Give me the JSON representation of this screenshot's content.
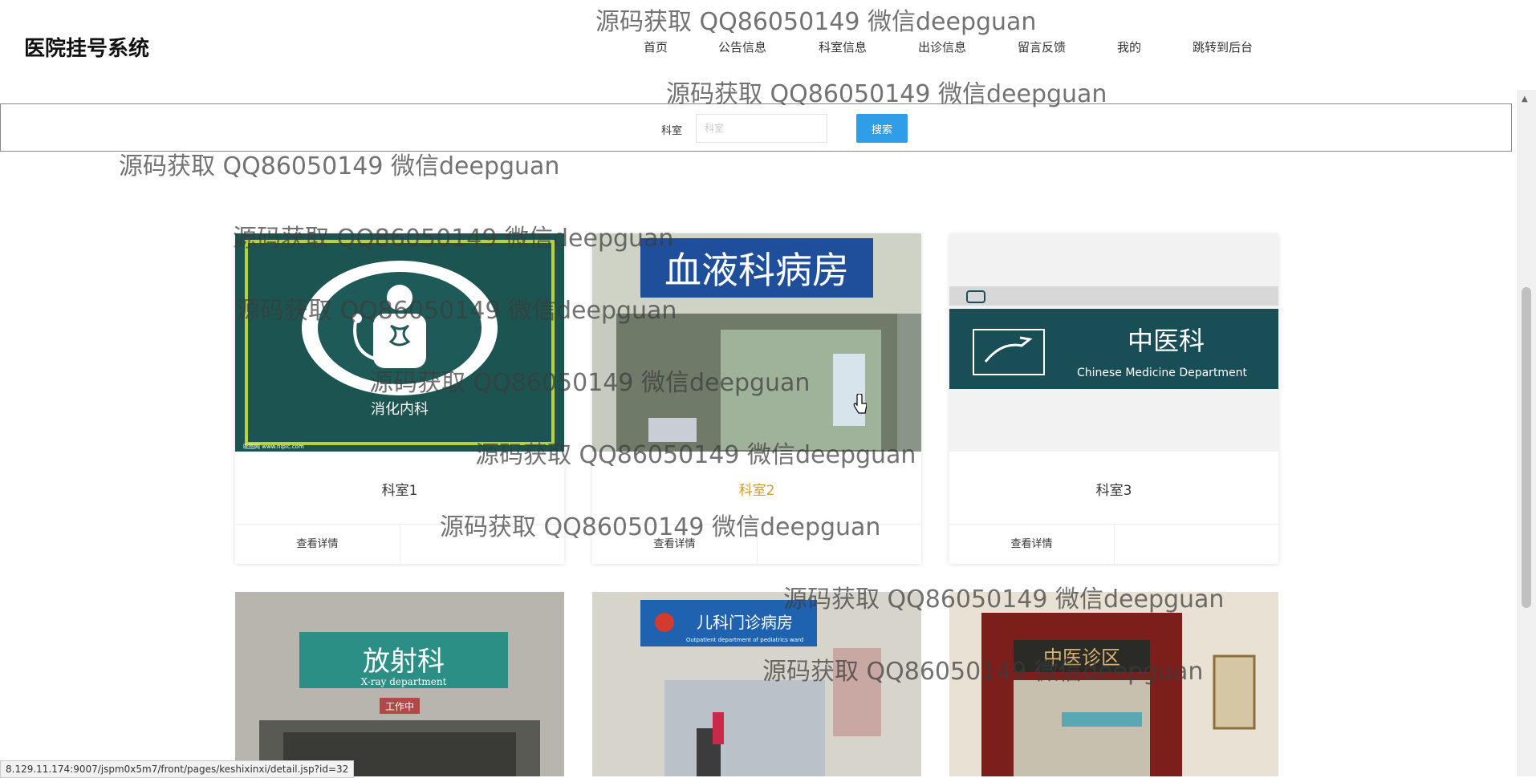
{
  "header": {
    "site_title": "医院挂号系统",
    "nav": [
      "首页",
      "公告信息",
      "科室信息",
      "出诊信息",
      "留言反馈",
      "我的",
      "跳转到后台"
    ]
  },
  "search": {
    "label": "科室",
    "placeholder": "科室",
    "value": "",
    "button": "搜索"
  },
  "cards": [
    {
      "title": "科室1",
      "detail": "查看详情",
      "image_text": "消化内科",
      "image_small": "昵图网 www.nipic.com"
    },
    {
      "title": "科室2",
      "detail": "查看详情",
      "image_text": "血液科病房"
    },
    {
      "title": "科室3",
      "detail": "查看详情",
      "image_text": "中医科",
      "image_sub": "Chinese Medicine Department"
    }
  ],
  "lower_images": [
    {
      "image_text": "放射科",
      "image_sub": "X-ray department",
      "image_tag": "工作中"
    },
    {
      "image_text": "儿科门诊病房",
      "image_sub": "Outpatient department of pediatrics ward"
    },
    {
      "image_text": "中医诊区"
    }
  ],
  "watermark": "源码获取 QQ86050149 微信deepguan",
  "status_url": "8.129.11.174:9007/jspm0x5m7/front/pages/keshixinxi/detail.jsp?id=32",
  "colors": {
    "accent": "#2f9de8",
    "hover_title": "#d79a2b",
    "teal": "#1e5a57"
  }
}
